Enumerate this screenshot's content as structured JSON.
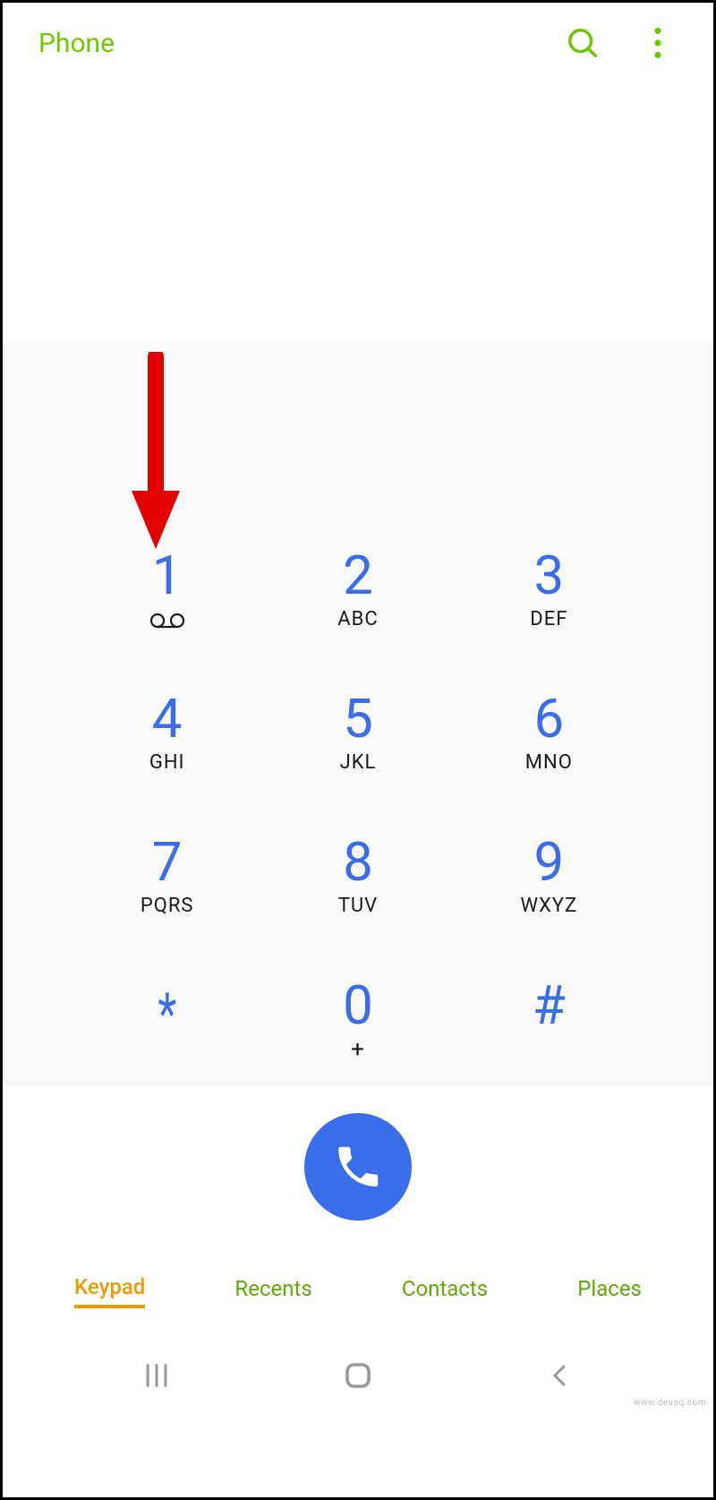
{
  "header": {
    "title": "Phone"
  },
  "keypad": {
    "keys": [
      {
        "digit": "1",
        "sub": "voicemail"
      },
      {
        "digit": "2",
        "sub": "ABC"
      },
      {
        "digit": "3",
        "sub": "DEF"
      },
      {
        "digit": "4",
        "sub": "GHI"
      },
      {
        "digit": "5",
        "sub": "JKL"
      },
      {
        "digit": "6",
        "sub": "MNO"
      },
      {
        "digit": "7",
        "sub": "PQRS"
      },
      {
        "digit": "8",
        "sub": "TUV"
      },
      {
        "digit": "9",
        "sub": "WXYZ"
      },
      {
        "digit": "*",
        "sub": ""
      },
      {
        "digit": "0",
        "sub": "+"
      },
      {
        "digit": "#",
        "sub": ""
      }
    ]
  },
  "tabs": {
    "items": [
      {
        "label": "Keypad",
        "active": true
      },
      {
        "label": "Recents",
        "active": false
      },
      {
        "label": "Contacts",
        "active": false
      },
      {
        "label": "Places",
        "active": false
      }
    ]
  },
  "colors": {
    "accent_green": "#6fc700",
    "key_blue": "#3a6dea",
    "active_orange": "#f19a00",
    "annotation_red": "#e30000"
  },
  "watermark": "www.deuaq.com"
}
